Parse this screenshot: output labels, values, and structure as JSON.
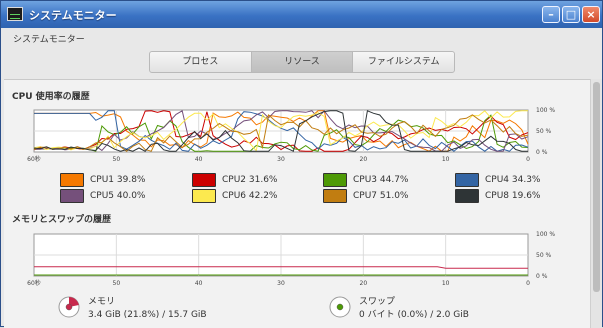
{
  "window": {
    "title": "システムモニター"
  },
  "menubar": {
    "label": "システムモニター"
  },
  "tabs": [
    {
      "label": "プロセス",
      "active": false
    },
    {
      "label": "リソース",
      "active": true
    },
    {
      "label": "ファイルシステム",
      "active": false
    }
  ],
  "cpu": {
    "title": "CPU 使用率の履歴",
    "y_ticks": [
      "100 %",
      "50 %",
      "0 %"
    ],
    "x_ticks": [
      "60秒",
      "50",
      "40",
      "30",
      "20",
      "10",
      "0"
    ],
    "cpus": [
      {
        "label": "CPU1",
        "value": "39.8%",
        "color": "#f57900"
      },
      {
        "label": "CPU2",
        "value": "31.6%",
        "color": "#cc0000"
      },
      {
        "label": "CPU3",
        "value": "44.7%",
        "color": "#4e9a06"
      },
      {
        "label": "CPU4",
        "value": "34.3%",
        "color": "#3465a4"
      },
      {
        "label": "CPU5",
        "value": "40.0%",
        "color": "#75507b"
      },
      {
        "label": "CPU6",
        "value": "42.2%",
        "color": "#fce94f"
      },
      {
        "label": "CPU7",
        "value": "51.0%",
        "color": "#c17d11"
      },
      {
        "label": "CPU8",
        "value": "19.6%",
        "color": "#2e3436"
      }
    ]
  },
  "memory": {
    "title": "メモリとスワップの履歴",
    "y_ticks": [
      "100 %",
      "50 %",
      "0 %"
    ],
    "x_ticks": [
      "60秒",
      "50",
      "40",
      "30",
      "20",
      "10",
      "0"
    ],
    "memory": {
      "label": "メモリ",
      "value": "3.4 GiB (21.8%) / 15.7 GiB",
      "color": "#c8294d",
      "fraction": 0.218
    },
    "swap": {
      "label": "スワップ",
      "value": "0 バイト (0.0%) / 2.0 GiB",
      "color": "#4e9a06",
      "fraction": 0.0
    }
  }
}
